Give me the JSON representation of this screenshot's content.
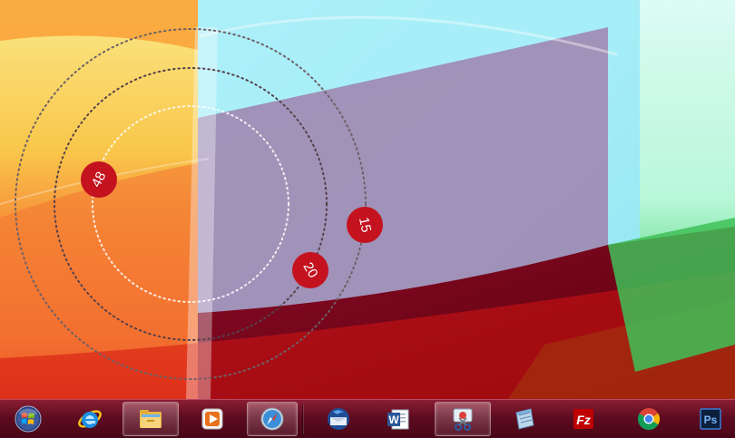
{
  "radial_menu": {
    "badges": [
      {
        "label": "48"
      },
      {
        "label": "20"
      },
      {
        "label": "15"
      }
    ],
    "badge_color": "#c4121f"
  },
  "taskbar": {
    "background_color": "#5e0c20",
    "items": [
      {
        "icon": "windows-start-orb-icon"
      },
      {
        "icon": "internet-explorer-icon"
      },
      {
        "icon": "windows-explorer-folder-icon"
      },
      {
        "icon": "windows-media-player-icon"
      },
      {
        "icon": "safari-compass-icon"
      },
      {
        "icon": "thunderbird-mail-icon"
      },
      {
        "icon": "word-icon",
        "text": "W"
      },
      {
        "icon": "snipping-tool-icon"
      },
      {
        "icon": "notepad-icon"
      },
      {
        "icon": "filezilla-icon",
        "text": "Fz"
      },
      {
        "icon": "chrome-icon"
      },
      {
        "icon": "photoshop-icon",
        "text": "Ps"
      }
    ]
  }
}
